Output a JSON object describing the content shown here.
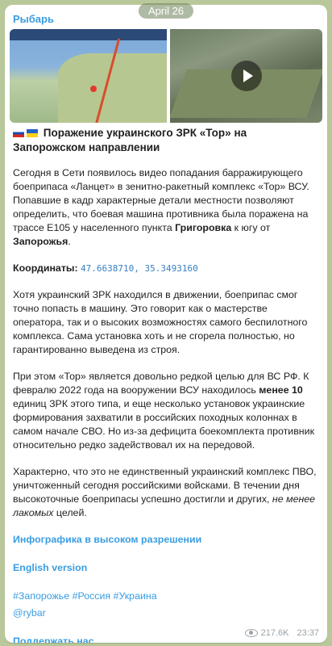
{
  "date_badge": "April 26",
  "channel_name": "Рыбарь",
  "title": "Поражение украинского ЗРК «Тор» на Запорожском направлении",
  "paragraph1": {
    "pre": "Сегодня в Сети появилось видео попадания барражирующего боеприпаса «Ланцет» в зенитно-ракетный комплекс «Тор» ВСУ. Попавшие в кадр характерные детали местности позволяют определить, что боевая машина противника была поражена на трассе Е105 у населенного пункта ",
    "bold": "Григоровка",
    "mid": " к югу от ",
    "bold2": "Запорожья",
    "post": "."
  },
  "coords": {
    "label": "Координаты:",
    "value": "47.6638710, 35.3493160"
  },
  "paragraph2": "Хотя украинский ЗРК находился в движении, боеприпас смог точно попасть в машину. Это говорит как о мастерстве оператора, так и о высоких возможностях самого беспилотного комплекса. Сама установка хоть и не сгорела полностью, но гарантированно выведена из строя.",
  "paragraph3": {
    "pre": "При этом «Тор» является довольно редкой целью для ВС РФ. К февралю 2022 года на вооружении ВСУ находилось ",
    "bold": "менее 10",
    "post": " единиц ЗРК этого типа, и еще несколько установок украинские формирования захватили в российских походных колоннах в самом начале СВО. Но из-за дефицита боекомплекта противник относительно редко задействовал их на передовой."
  },
  "paragraph4": {
    "pre": "Характерно, что это не единственный украинский комплекс ПВО, уничтоженный сегодня российскими войсками. В течении дня высокоточные боеприпасы успешно достигли и других, ",
    "italic": "не менее лакомых",
    "post": " целей."
  },
  "links": {
    "infographic": "Инфографика в высоком разрешении",
    "english": "English version",
    "hashtags": "#Запорожье #Россия #Украина",
    "handle": "@rybar",
    "support": "Поддержать нас"
  },
  "views": "217.6K",
  "time": "23:37"
}
